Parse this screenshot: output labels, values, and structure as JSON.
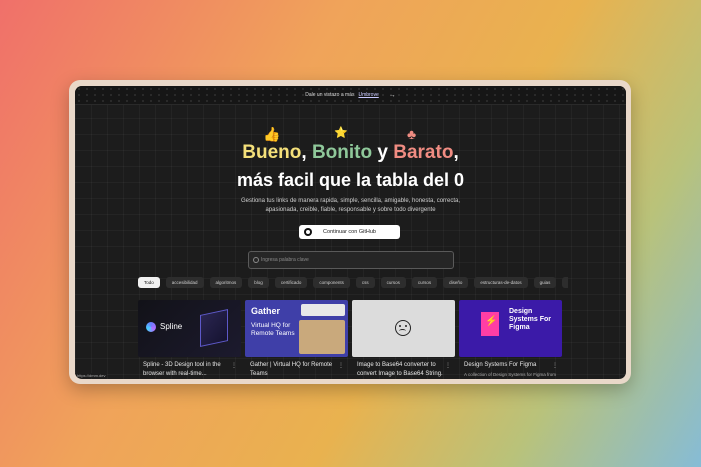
{
  "topbar": {
    "text": "Dale un vistazo a más",
    "brand": "Umbrove",
    "arrow": "→"
  },
  "headline": {
    "word1": "Bueno",
    "comma1": ",",
    "word2": "Bonito",
    "and": "y",
    "word3": "Barato",
    "comma2": ",",
    "line2": "más facil que la tabla del 0"
  },
  "emojis": {
    "thumb": "👍",
    "stars": "⭐",
    "clubs": "♣"
  },
  "subtitle": "Gestiona tus links de manera rapida, simple, sencilla, amigable, honesta, correcta, apasionada, creible, fiable, responsable y sobre todo divergente",
  "github_button": "Continuar con GitHub",
  "search": {
    "placeholder": "Ingresa palabra clave"
  },
  "tags": [
    "Todo",
    "accesibilidad",
    "algoritmos",
    "blog",
    "certificado",
    "components",
    "css",
    "cursos",
    "cursos",
    "diseño",
    "estructuras-de-datos",
    "guias",
    "herramient"
  ],
  "cards": [
    {
      "title": "Spline - 3D Design tool in the browser with real-time...",
      "thumb_text": "Spline"
    },
    {
      "title": "Gather | Virtual HQ for Remote Teams",
      "thumb_logo": "Gather",
      "thumb_text": "Virtual HQ for Remote Teams"
    },
    {
      "title": "Image to Base64 converter to convert Image to Base64 String."
    },
    {
      "title": "Design Systems For Figma",
      "thumb_text": "Design Systems For Figma",
      "desc": "A collection of Design Systems for Figma from"
    }
  ],
  "status_url": "https://dmm.dev",
  "colors": {
    "bueno": "#f4e07a",
    "bonito": "#8fc89a",
    "barato": "#f08c82"
  }
}
